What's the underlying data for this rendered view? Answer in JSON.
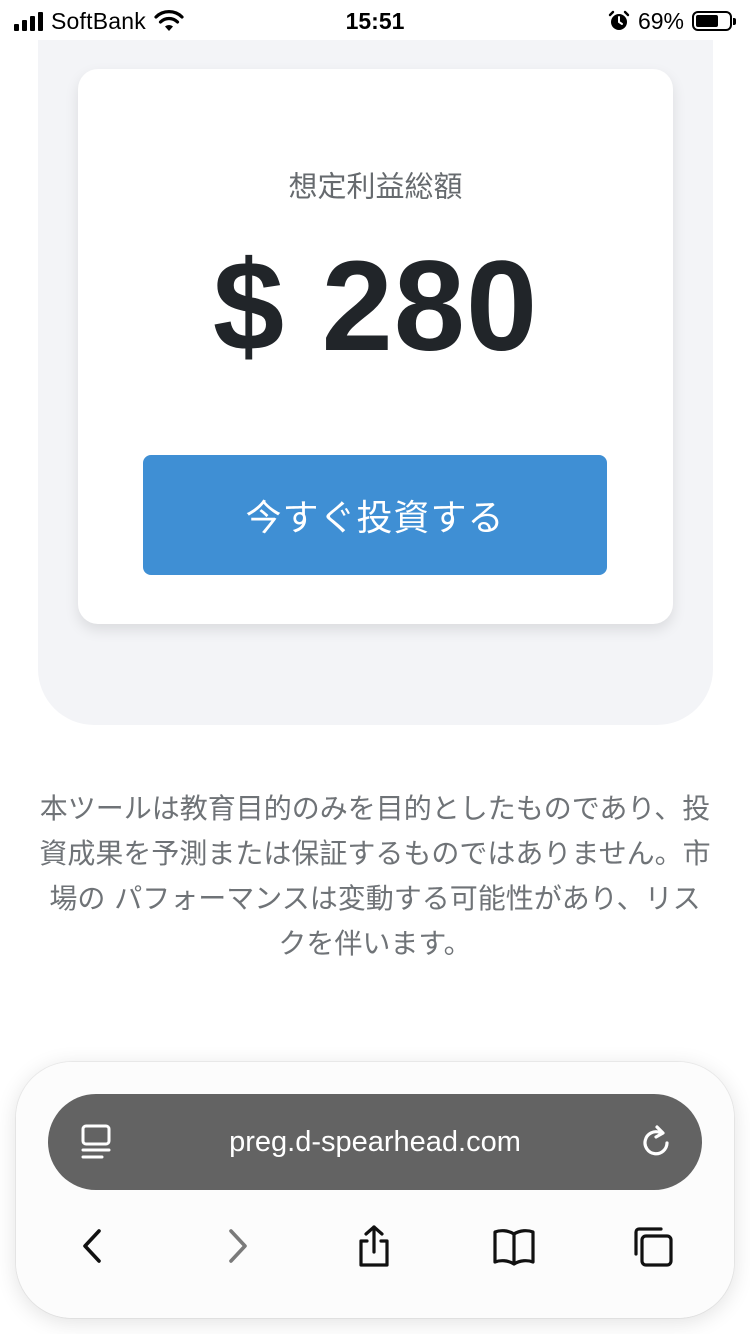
{
  "status_bar": {
    "carrier": "SoftBank",
    "time": "15:51",
    "battery_percent": "69%",
    "battery_level": 0.69,
    "signal_icon": "cellular-signal-icon",
    "wifi_icon": "wifi-icon",
    "alarm_icon": "alarm-clock-icon",
    "battery_icon": "battery-icon"
  },
  "card": {
    "label": "想定利益総額",
    "amount": "$ 280",
    "button_label": "今すぐ投資する",
    "button_color": "#3f8fd4"
  },
  "disclaimer": "本ツールは教育目的のみを目的としたものであり、投資成果を予測または保証するものではありません。市場の パフォーマンスは変動する可能性があり、リスクを伴います。",
  "browser": {
    "url": "preg.d-spearhead.com",
    "reader_icon": "reader-page-menu-icon",
    "reload_icon": "reload-icon",
    "nav": {
      "back": "chevron-left-icon",
      "forward": "chevron-right-icon",
      "share": "share-icon",
      "bookmarks": "book-icon",
      "tabs": "tabs-icon"
    }
  }
}
